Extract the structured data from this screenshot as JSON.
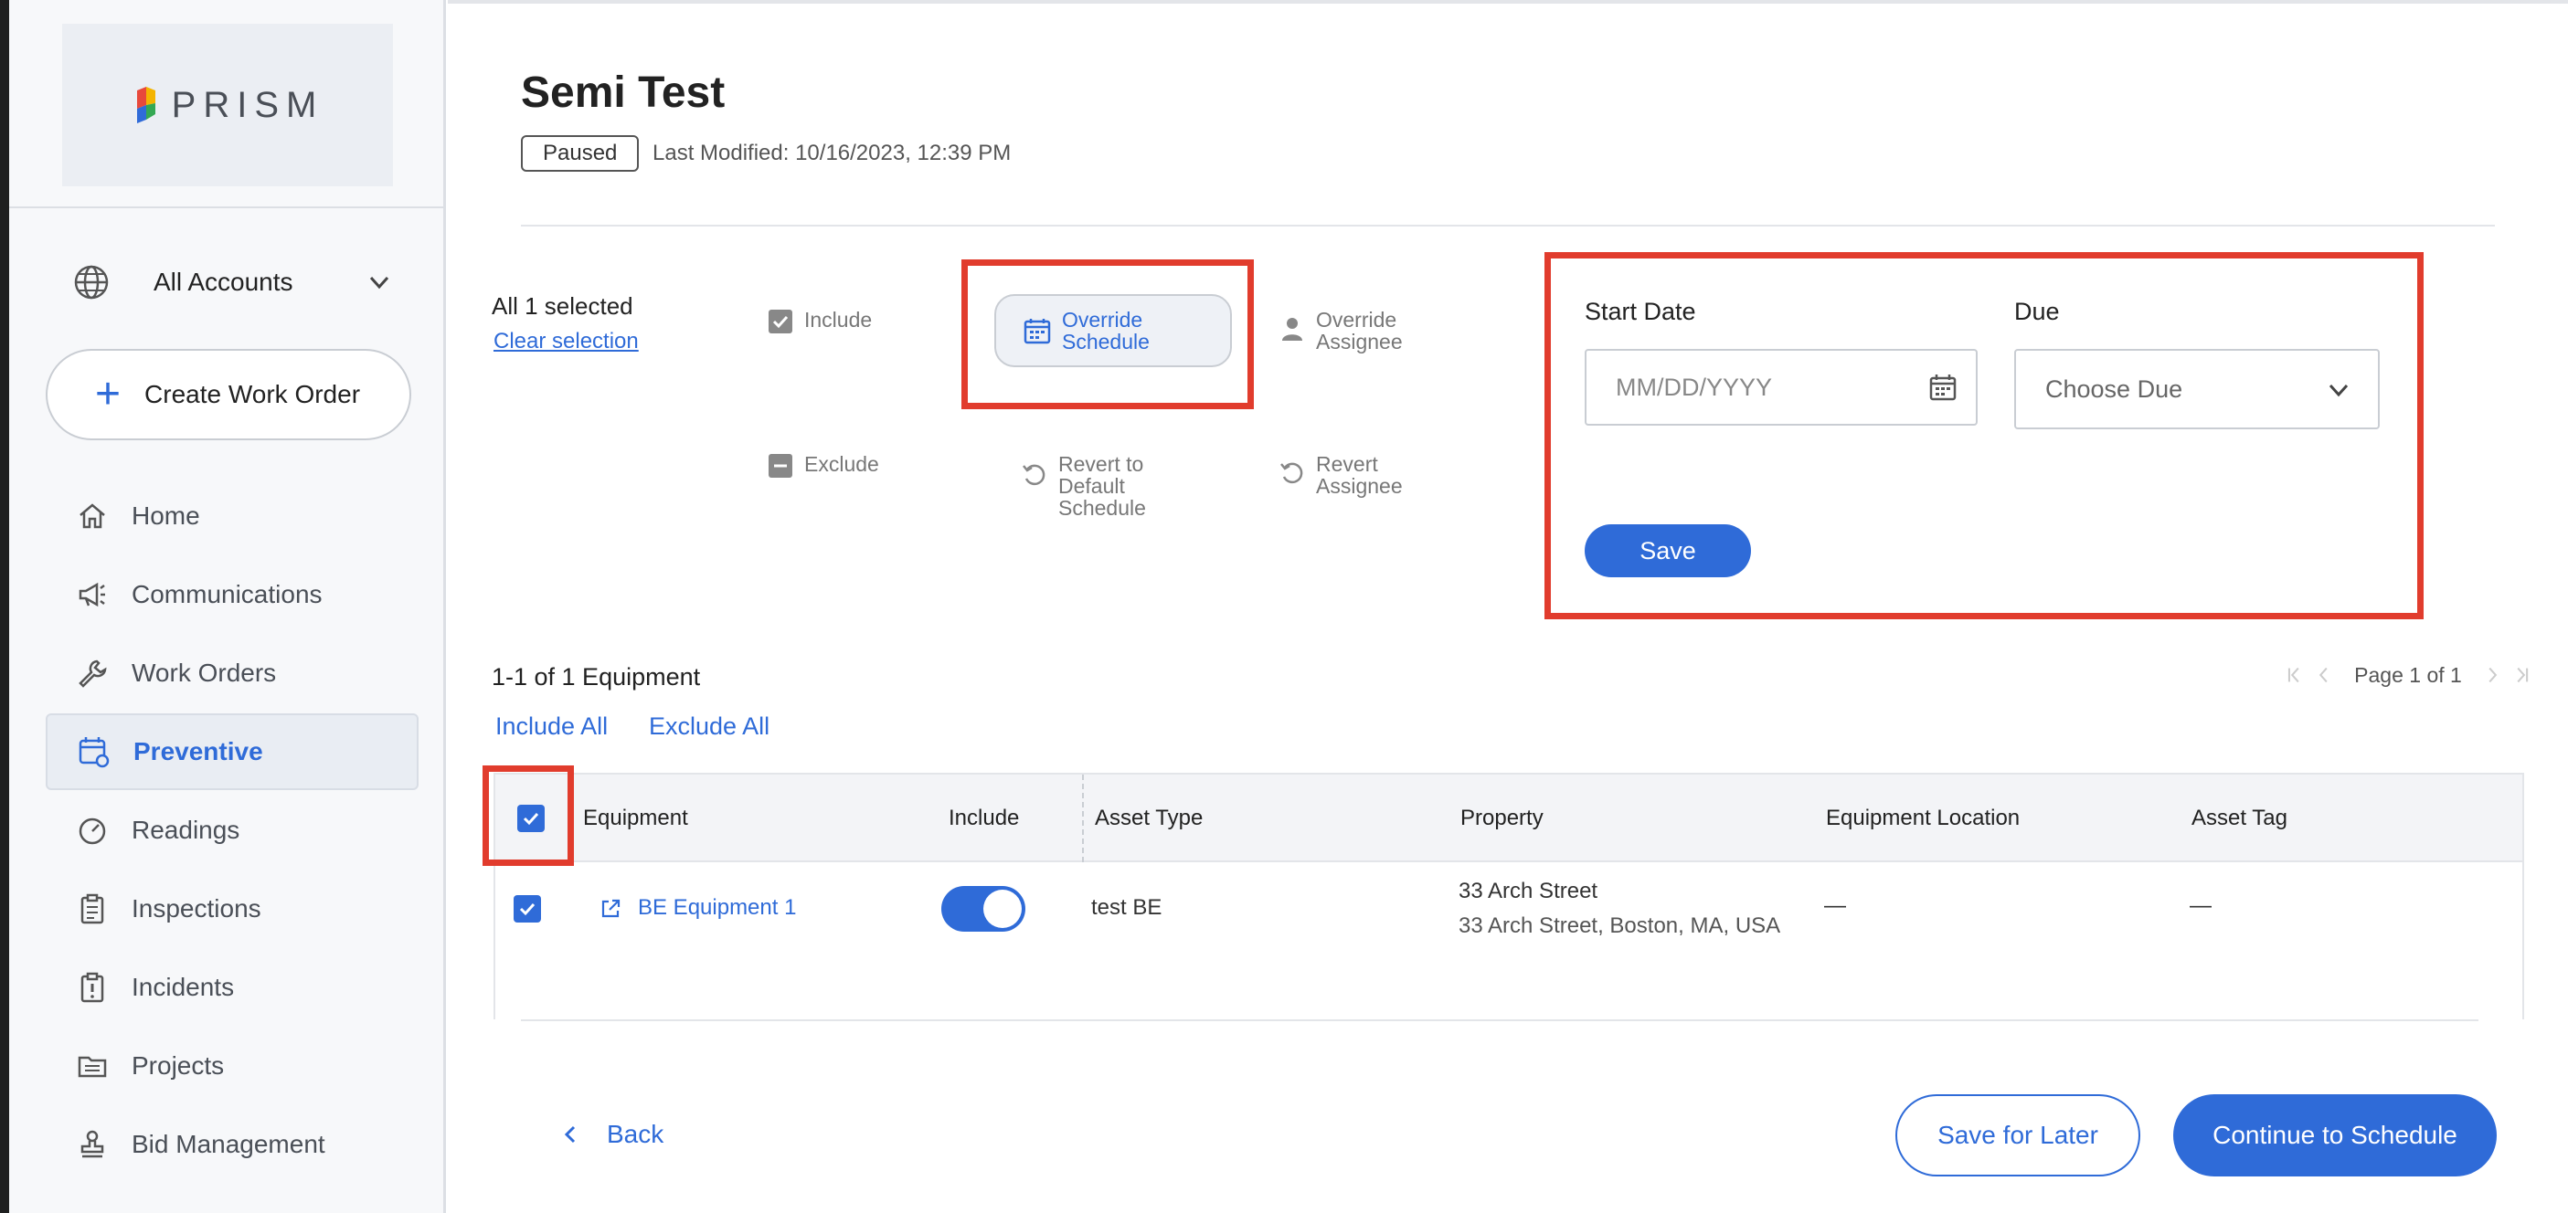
{
  "sidebar": {
    "logo_text": "PRISM",
    "account_selector": "All Accounts",
    "create_button": "Create Work Order",
    "items": [
      {
        "label": "Home",
        "icon": "home-icon"
      },
      {
        "label": "Communications",
        "icon": "megaphone-icon"
      },
      {
        "label": "Work Orders",
        "icon": "wrench-icon"
      },
      {
        "label": "Preventive",
        "icon": "calendar-refresh-icon",
        "active": true
      },
      {
        "label": "Readings",
        "icon": "gauge-icon"
      },
      {
        "label": "Inspections",
        "icon": "clipboard-icon"
      },
      {
        "label": "Incidents",
        "icon": "alert-clipboard-icon"
      },
      {
        "label": "Projects",
        "icon": "folder-icon"
      },
      {
        "label": "Bid Management",
        "icon": "stamp-icon"
      }
    ]
  },
  "header": {
    "title": "Semi Test",
    "status": "Paused",
    "last_modified": "Last Modified: 10/16/2023, 12:39 PM"
  },
  "selection": {
    "count_text": "All 1 selected",
    "clear_label": "Clear selection"
  },
  "actions": {
    "include": "Include",
    "exclude": "Exclude",
    "override_schedule": [
      "Override",
      "Schedule"
    ],
    "revert_schedule": [
      "Revert to",
      "Default",
      "Schedule"
    ],
    "override_assignee": [
      "Override",
      "Assignee"
    ],
    "revert_assignee": [
      "Revert",
      "Assignee"
    ]
  },
  "schedule_panel": {
    "start_label": "Start Date",
    "start_placeholder": "MM/DD/YYYY",
    "due_label": "Due",
    "due_placeholder": "Choose Due",
    "save_label": "Save"
  },
  "equipment": {
    "count_text": "1-1 of 1 Equipment",
    "include_all": "Include All",
    "exclude_all": "Exclude All",
    "pager_text": "Page 1 of 1",
    "columns": [
      "Equipment",
      "Include",
      "Asset Type",
      "Property",
      "Equipment Location",
      "Asset Tag"
    ],
    "rows": [
      {
        "name": "BE Equipment 1",
        "include": true,
        "asset_type": "test BE",
        "property_name": "33 Arch Street",
        "property_address": "33 Arch Street, Boston, MA, USA",
        "location": "—",
        "asset_tag": "—"
      }
    ]
  },
  "footer": {
    "back": "Back",
    "save_later": "Save for Later",
    "continue": "Continue to Schedule"
  },
  "colors": {
    "accent": "#2f6bd8",
    "highlight": "#e13c2d"
  }
}
